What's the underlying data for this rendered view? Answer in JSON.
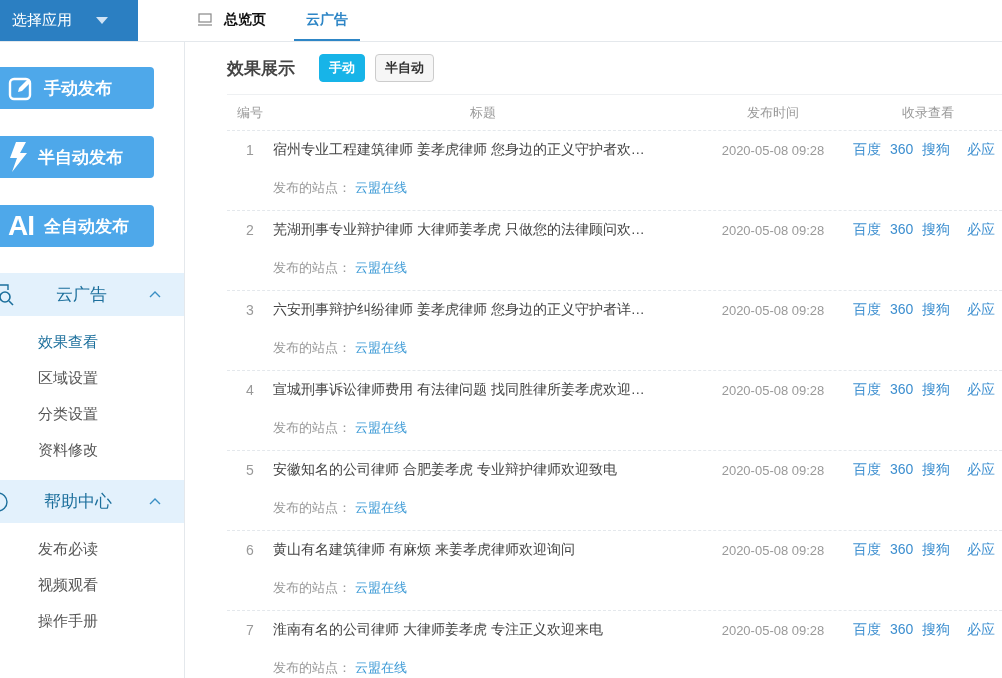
{
  "app_switcher": {
    "label": "选择应用"
  },
  "tabs": [
    {
      "label": "总览页",
      "selected": false
    },
    {
      "label": "云广告",
      "selected": true
    }
  ],
  "publish_buttons": [
    {
      "label": "手动发布",
      "kind": "edit"
    },
    {
      "label": "半自动发布",
      "kind": "bolt"
    },
    {
      "label": "全自动发布",
      "kind": "ai",
      "badge": "AI"
    }
  ],
  "sidebar": {
    "sections": [
      {
        "title": "云广告",
        "kind": "search",
        "expanded": true,
        "items": [
          {
            "label": "效果查看",
            "selected": true
          },
          {
            "label": "区域设置",
            "selected": false
          },
          {
            "label": "分类设置",
            "selected": false
          },
          {
            "label": "资料修改",
            "selected": false
          }
        ]
      },
      {
        "title": "帮助中心",
        "kind": "help",
        "expanded": true,
        "items": [
          {
            "label": "发布必读",
            "selected": false
          },
          {
            "label": "视频观看",
            "selected": false
          },
          {
            "label": "操作手册",
            "selected": false
          }
        ]
      }
    ]
  },
  "panel": {
    "title": "效果展示",
    "modes": [
      {
        "label": "手动",
        "selected": true
      },
      {
        "label": "半自动",
        "selected": false
      }
    ]
  },
  "table": {
    "columns": [
      "编号",
      "标题",
      "发布时间",
      "收录查看"
    ],
    "rows": [
      {
        "no": "1",
        "title": "宿州专业工程建筑律师 姜孝虎律师 您身边的正义守护者欢…",
        "time": "2020-05-08 09:28",
        "site_label": "发布的站点：",
        "site": "云盟在线",
        "engines": [
          "百度",
          "360",
          "搜狗",
          "必应"
        ]
      },
      {
        "no": "2",
        "title": "芜湖刑事专业辩护律师 大律师姜孝虎 只做您的法律顾问欢…",
        "time": "2020-05-08 09:28",
        "site_label": "发布的站点：",
        "site": "云盟在线",
        "engines": [
          "百度",
          "360",
          "搜狗",
          "必应"
        ]
      },
      {
        "no": "3",
        "title": "六安刑事辩护纠纷律师 姜孝虎律师 您身边的正义守护者详…",
        "time": "2020-05-08 09:28",
        "site_label": "发布的站点：",
        "site": "云盟在线",
        "engines": [
          "百度",
          "360",
          "搜狗",
          "必应"
        ]
      },
      {
        "no": "4",
        "title": "宣城刑事诉讼律师费用 有法律问题 找同胜律所姜孝虎欢迎…",
        "time": "2020-05-08 09:28",
        "site_label": "发布的站点：",
        "site": "云盟在线",
        "engines": [
          "百度",
          "360",
          "搜狗",
          "必应"
        ]
      },
      {
        "no": "5",
        "title": "安徽知名的公司律师 合肥姜孝虎 专业辩护律师欢迎致电",
        "time": "2020-05-08 09:28",
        "site_label": "发布的站点：",
        "site": "云盟在线",
        "engines": [
          "百度",
          "360",
          "搜狗",
          "必应"
        ]
      },
      {
        "no": "6",
        "title": "黄山有名建筑律师 有麻烦 来姜孝虎律师欢迎询问",
        "time": "2020-05-08 09:28",
        "site_label": "发布的站点：",
        "site": "云盟在线",
        "engines": [
          "百度",
          "360",
          "搜狗",
          "必应"
        ]
      },
      {
        "no": "7",
        "title": "淮南有名的公司律师 大律师姜孝虎 专注正义欢迎来电",
        "time": "2020-05-08 09:28",
        "site_label": "发布的站点：",
        "site": "云盟在线",
        "engines": [
          "百度",
          "360",
          "搜狗",
          "必应"
        ]
      }
    ]
  }
}
